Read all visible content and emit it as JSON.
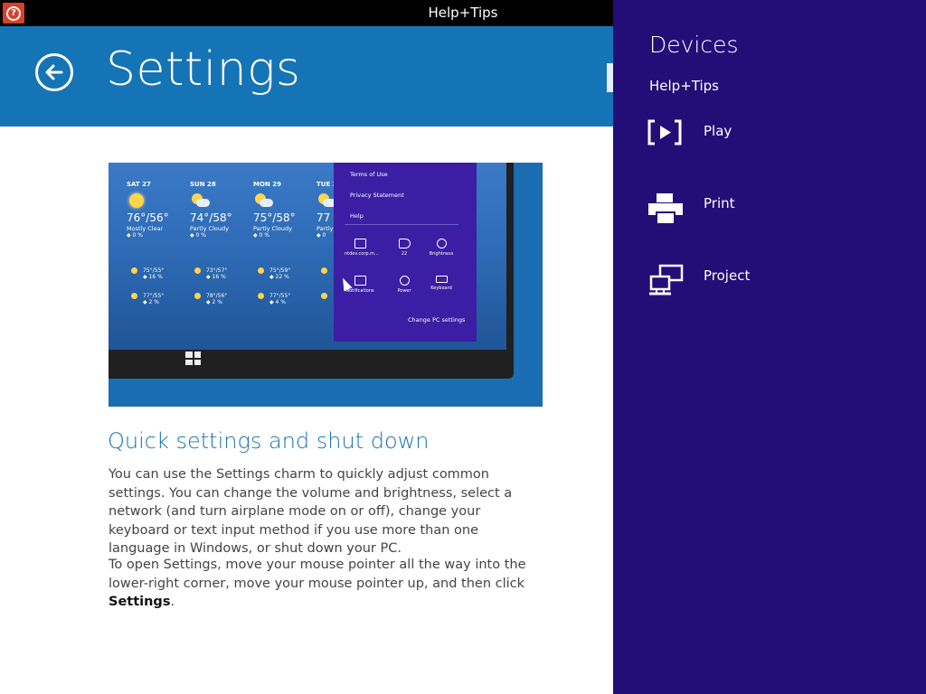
{
  "titlebar": {
    "title": "Help+Tips",
    "app_icon": "help-icon"
  },
  "header": {
    "title": "Settings",
    "back_icon": "back-arrow-icon"
  },
  "hero": {
    "days": [
      {
        "name": "SAT 27",
        "temp": "76°/56°",
        "desc": "Mostly Clear",
        "pct": "◆ 0 %",
        "icon": "sun-icon",
        "rows": [
          "75°/55°",
          "◆ 16 %",
          "77°/55°",
          "◆ 2 %"
        ]
      },
      {
        "name": "SUN 28",
        "temp": "74°/58°",
        "desc": "Partly Cloudy",
        "pct": "◆ 0 %",
        "icon": "partly-cloudy-icon",
        "rows": [
          "73°/57°",
          "◆ 16 %",
          "78°/56°",
          "◆ 2 %"
        ]
      },
      {
        "name": "MON 29",
        "temp": "75°/58°",
        "desc": "Partly Cloudy",
        "pct": "◆ 0 %",
        "icon": "partly-cloudy-icon",
        "rows": [
          "75°/59°",
          "◆ 22 %",
          "77°/55°",
          "◆ 4 %"
        ]
      },
      {
        "name": "TUE 3",
        "temp": "77",
        "desc": "Partly",
        "pct": "◆ 0",
        "icon": "partly-cloudy-icon",
        "rows": [
          "",
          "",
          "",
          ""
        ]
      }
    ],
    "charm": {
      "links": [
        "Terms of Use",
        "Privacy Statement",
        "Help"
      ],
      "tiles": [
        {
          "label": "ntdev.corp.m...",
          "icon": "network-icon"
        },
        {
          "label": "22",
          "icon": "volume-icon"
        },
        {
          "label": "Brightness",
          "icon": "brightness-icon"
        },
        {
          "label": "Notifications",
          "icon": "notifications-icon"
        },
        {
          "label": "Power",
          "icon": "power-icon"
        },
        {
          "label": "Keyboard",
          "icon": "keyboard-icon"
        }
      ],
      "change": "Change PC settings"
    }
  },
  "content": {
    "section_title": "Quick settings and shut down",
    "para1": "You can use the Settings charm to quickly adjust common settings. You can change the volume and brightness, select a network (and turn airplane mode on or off), change your keyboard or text input method if you use more than one language in Windows, or shut down your PC.",
    "para2_prefix": "To open Settings, move your mouse pointer all the way into the lower-right corner, move your mouse pointer up, and then click ",
    "para2_bold": "Settings",
    "para2_suffix": "."
  },
  "flyout": {
    "title": "Devices",
    "subtitle": "Help+Tips",
    "items": [
      {
        "label": "Play",
        "icon": "play-to-device-icon"
      },
      {
        "label": "Print",
        "icon": "printer-icon"
      },
      {
        "label": "Project",
        "icon": "project-screen-icon"
      }
    ]
  },
  "colors": {
    "header": "#1574b5",
    "flyout": "#230e78",
    "accent_text": "#1a73b5"
  }
}
